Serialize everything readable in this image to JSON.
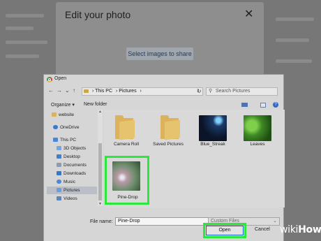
{
  "modal": {
    "title": "Edit your photo",
    "close_glyph": "✕",
    "select_button": "Select images to share"
  },
  "dialog": {
    "title": "Open",
    "breadcrumb": [
      "This PC",
      "Pictures"
    ],
    "search_placeholder": "Search Pictures",
    "organize_label": "Organize ▾",
    "new_folder_label": "New folder",
    "sidebar": [
      {
        "label": "website",
        "icon": "folder-icon"
      },
      {
        "label": "OneDrive",
        "icon": "cloud-icon"
      },
      {
        "label": "This PC",
        "icon": "pc-icon"
      },
      {
        "label": "3D Objects",
        "icon": "cube-icon"
      },
      {
        "label": "Desktop",
        "icon": "desktop-icon"
      },
      {
        "label": "Documents",
        "icon": "documents-icon"
      },
      {
        "label": "Downloads",
        "icon": "download-icon"
      },
      {
        "label": "Music",
        "icon": "music-icon"
      },
      {
        "label": "Pictures",
        "icon": "pictures-icon",
        "selected": true
      },
      {
        "label": "Videos",
        "icon": "video-icon"
      }
    ],
    "files": [
      {
        "label": "Camera Roll",
        "kind": "folder"
      },
      {
        "label": "Saved Pictures",
        "kind": "folder"
      },
      {
        "label": "Blue_Streak",
        "kind": "image"
      },
      {
        "label": "Leaves",
        "kind": "image"
      },
      {
        "label": "Pine-Drop",
        "kind": "image",
        "highlighted": true
      }
    ],
    "filename_label": "File name:",
    "filename_value": "Pine-Drop",
    "filter_value": "Custom Files",
    "open_label": "Open",
    "cancel_label": "Cancel"
  },
  "watermark": {
    "wiki": "wiki",
    "how": "How"
  },
  "colors": {
    "highlight": "#2ce83a",
    "accent": "#1e5ec8"
  }
}
